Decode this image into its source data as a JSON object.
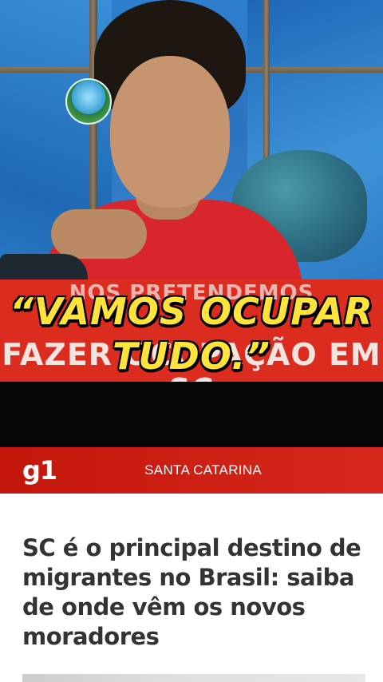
{
  "overlay": {
    "quote_line_1": "“VAMOS OCUPAR",
    "quote_line_2": "TUDO.”",
    "background_line_1": "NOS PRETENDEMOS",
    "background_line_2": "FAZER OCUPAÇÃO EM SC",
    "quote_color": "#fde33b",
    "banner_color": "#dc2b1f"
  },
  "news": {
    "logo": "g1",
    "section": "SANTA CATARINA",
    "brand_color": "#c4170c",
    "headline": "SC é o principal destino de migrantes no Brasil: saiba de onde vêm os novos moradores"
  },
  "icons": {
    "channel_logo": "channel-logo-icon"
  }
}
